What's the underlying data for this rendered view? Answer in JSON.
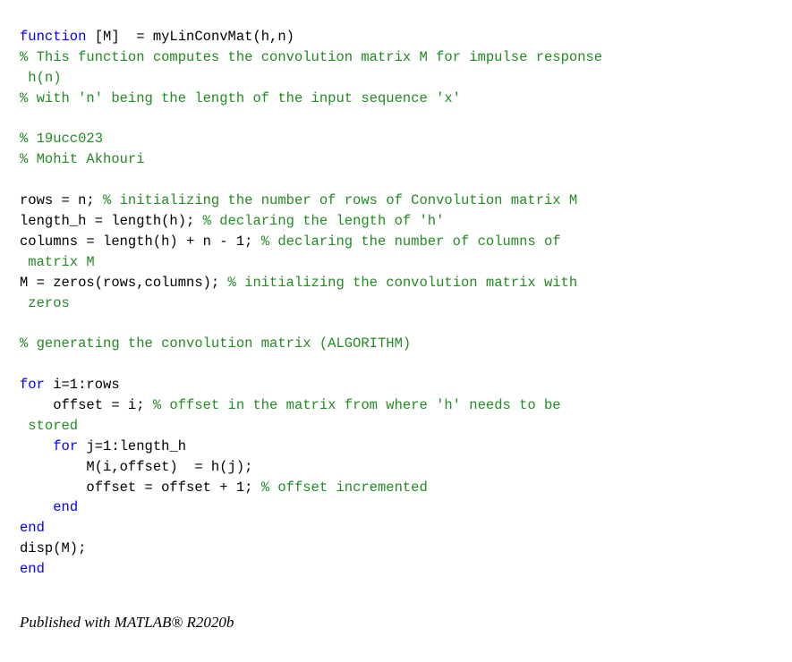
{
  "colors": {
    "keyword": "#0000ff",
    "comment": "#228b22",
    "text": "#000000",
    "background": "#ffffff"
  },
  "code_lines": [
    [
      {
        "k": "kw",
        "t": "function"
      },
      {
        "k": "tx",
        "t": " [M]  = myLinConvMat(h,n)"
      }
    ],
    [
      {
        "k": "cm",
        "t": "% This function computes the convolution matrix M for impulse response"
      }
    ],
    [
      {
        "k": "cm",
        "t": " h(n)"
      }
    ],
    [
      {
        "k": "cm",
        "t": "% with 'n' being the length of the input sequence 'x'"
      }
    ],
    [],
    [
      {
        "k": "cm",
        "t": "% 19ucc023"
      }
    ],
    [
      {
        "k": "cm",
        "t": "% Mohit Akhouri"
      }
    ],
    [],
    [
      {
        "k": "tx",
        "t": "rows = n; "
      },
      {
        "k": "cm",
        "t": "% initializing the number of rows of Convolution matrix M"
      }
    ],
    [
      {
        "k": "tx",
        "t": "length_h = length(h); "
      },
      {
        "k": "cm",
        "t": "% declaring the length of 'h'"
      }
    ],
    [
      {
        "k": "tx",
        "t": "columns = length(h) + n - 1; "
      },
      {
        "k": "cm",
        "t": "% declaring the number of columns of"
      }
    ],
    [
      {
        "k": "cm",
        "t": " matrix M"
      }
    ],
    [
      {
        "k": "tx",
        "t": "M = zeros(rows,columns); "
      },
      {
        "k": "cm",
        "t": "% initializing the convolution matrix with"
      }
    ],
    [
      {
        "k": "cm",
        "t": " zeros"
      }
    ],
    [],
    [
      {
        "k": "cm",
        "t": "% generating the convolution matrix (ALGORITHM)"
      }
    ],
    [],
    [
      {
        "k": "kw",
        "t": "for"
      },
      {
        "k": "tx",
        "t": " i=1:rows"
      }
    ],
    [
      {
        "k": "tx",
        "t": "    offset = i; "
      },
      {
        "k": "cm",
        "t": "% offset in the matrix from where 'h' needs to be"
      }
    ],
    [
      {
        "k": "cm",
        "t": " stored"
      }
    ],
    [
      {
        "k": "tx",
        "t": "    "
      },
      {
        "k": "kw",
        "t": "for"
      },
      {
        "k": "tx",
        "t": " j=1:length_h"
      }
    ],
    [
      {
        "k": "tx",
        "t": "        M(i,offset)  = h(j);"
      }
    ],
    [
      {
        "k": "tx",
        "t": "        offset = offset + 1; "
      },
      {
        "k": "cm",
        "t": "% offset incremented"
      }
    ],
    [
      {
        "k": "tx",
        "t": "    "
      },
      {
        "k": "kw",
        "t": "end"
      }
    ],
    [
      {
        "k": "kw",
        "t": "end"
      }
    ],
    [
      {
        "k": "tx",
        "t": "disp(M);"
      }
    ],
    [
      {
        "k": "kw",
        "t": "end"
      }
    ]
  ],
  "footer": {
    "text": "Published with MATLAB® R2020b"
  }
}
